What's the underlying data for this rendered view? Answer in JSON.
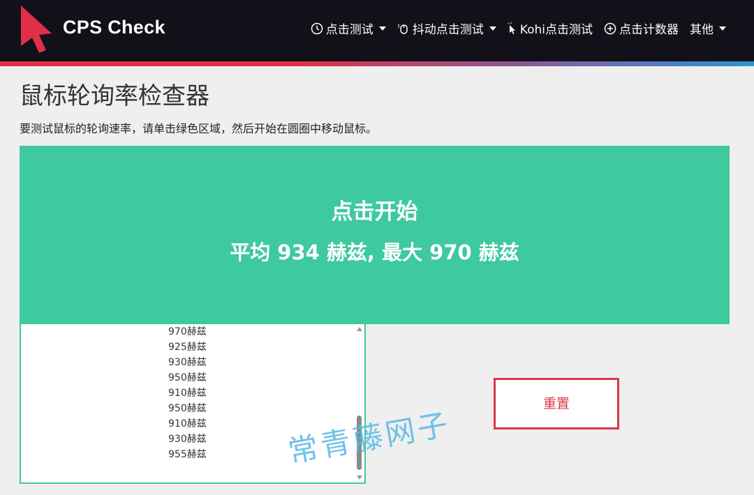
{
  "header": {
    "brand": "CPS Check",
    "nav": [
      {
        "label": "点击测试",
        "icon": "clock-icon",
        "has_dropdown": true
      },
      {
        "label": "抖动点击测试",
        "icon": "jitter-click-icon",
        "has_dropdown": true
      },
      {
        "label": "Kohi点击测试",
        "icon": "cursor-icon",
        "has_dropdown": false
      },
      {
        "label": "点击计数器",
        "icon": "plus-circle-icon",
        "has_dropdown": false
      },
      {
        "label": "其他",
        "icon": "",
        "has_dropdown": true
      }
    ]
  },
  "main": {
    "title": "鼠标轮询率检查器",
    "instructions": "要测试鼠标的轮询速率，请单击绿色区域，然后开始在圆圈中移动鼠标。",
    "test_area": {
      "start_label": "点击开始",
      "stats": "平均 934 赫兹, 最大 970 赫兹"
    },
    "log": [
      "970赫兹",
      "925赫兹",
      "930赫兹",
      "950赫兹",
      "910赫兹",
      "950赫兹",
      "910赫兹",
      "930赫兹",
      "955赫兹"
    ],
    "reset_label": "重置"
  },
  "watermark": "常青藤网子",
  "colors": {
    "header_bg": "#121019",
    "test_area": "#3ec99f",
    "reset": "#dc3545",
    "brand_accent": "#e03047"
  }
}
